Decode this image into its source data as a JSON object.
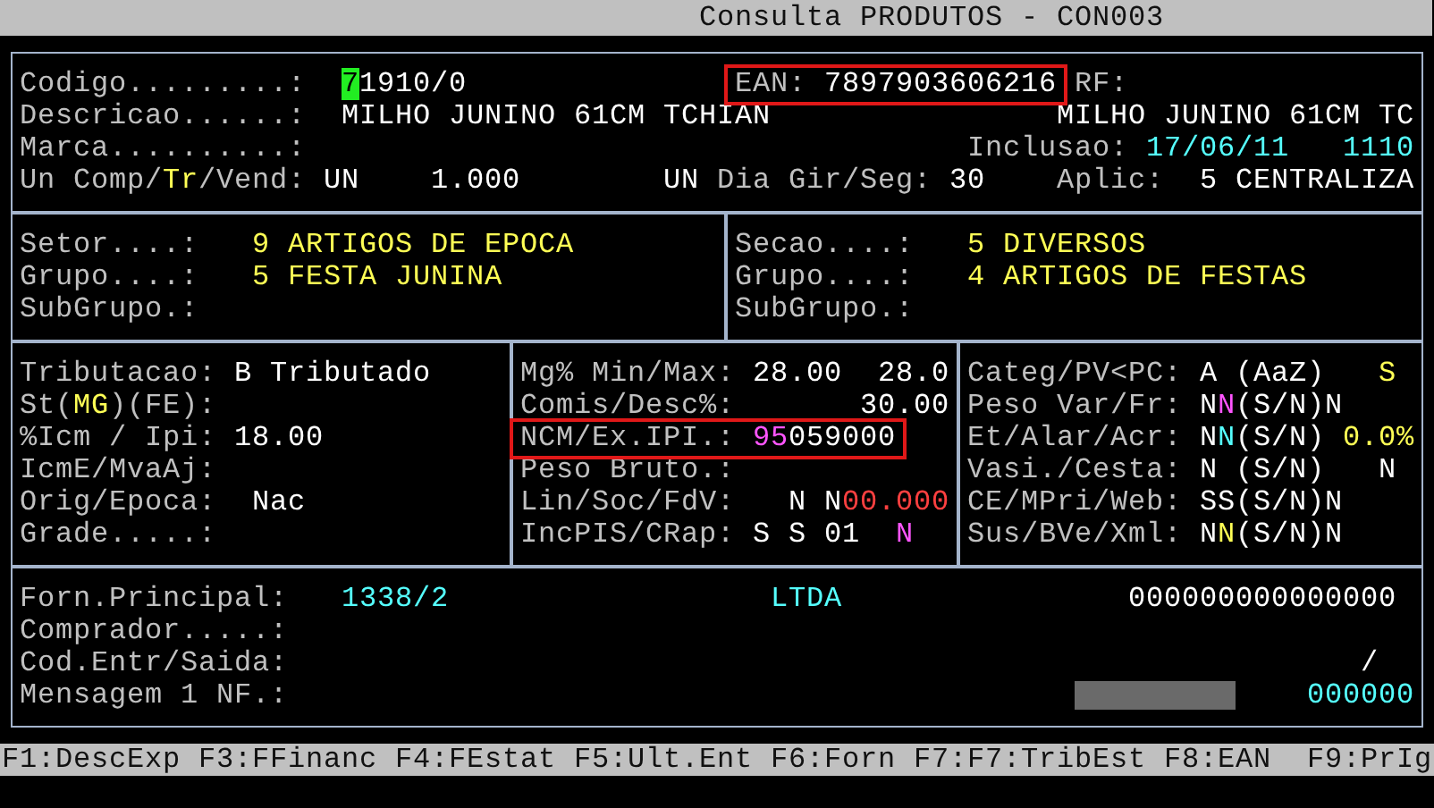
{
  "title": "Consulta PRODUTOS - CON003",
  "header": [
    [
      {
        "text": "Codigo.........:",
        "color": "#c0c0c0",
        "highlighted": false
      },
      {
        "text": "**7**1910/0",
        "color": "#ffffff",
        "cursor": true,
        "highlighted": false
      },
      {
        "text": "EAN:",
        "color": "#c0c0c0",
        "highlighted": true
      },
      {
        "text": "7897903606216",
        "color": "#ffffff",
        "highlighted": true
      },
      {
        "text": "RF:",
        "color": "#c0c0c0",
        "highlighted": false
      }
    ],
    [
      {
        "text": "Descricao......:",
        "color": "#c0c0c0"
      },
      {
        "text": "MILHO JUNINO 61CM TCHIAN",
        "color": "#ffffff"
      },
      {
        "text": "MILHO JUNINO 61CM TC",
        "color": "#ffffff"
      }
    ],
    [
      {
        "text": "Marca..........:",
        "color": "#c0c0c0"
      },
      {
        "text": "Inclusao:",
        "color": "#c0c0c0"
      },
      {
        "text": "17/06/11",
        "color": "#55ffff"
      },
      {
        "text": "1110",
        "color": "#55ffff"
      }
    ],
    [
      {
        "text": "Un Comp/**Tr**/Vend:",
        "color": "#c0c0c0",
        "accent": {
          "color": "#ffff55"
        }
      },
      {
        "text": "UN",
        "color": "#ffffff"
      },
      {
        "text": "1.000",
        "color": "#ffffff"
      },
      {
        "text": "UN",
        "color": "#ffffff"
      },
      {
        "text": "Dia Gir/Seg:",
        "color": "#c0c0c0"
      },
      {
        "text": "30",
        "color": "#ffffff"
      },
      {
        "text": "Aplic:",
        "color": "#c0c0c0"
      },
      {
        "text": "5 CENTRALIZA",
        "color": "#ffffff"
      }
    ]
  ],
  "classification": {
    "left": [
      [
        {
          "text": "Setor....:",
          "color": "#c0c0c0"
        },
        {
          "text": "9 ARTIGOS DE EPOCA",
          "color": "#ffff55"
        }
      ],
      [
        {
          "text": "Grupo....:",
          "color": "#c0c0c0"
        },
        {
          "text": "5 FESTA JUNINA",
          "color": "#ffff55"
        }
      ],
      [
        {
          "text": "SubGrupo.:",
          "color": "#c0c0c0"
        }
      ]
    ],
    "right": [
      [
        {
          "text": "Secao....:",
          "color": "#c0c0c0"
        },
        {
          "text": "5 DIVERSOS",
          "color": "#ffff55"
        }
      ],
      [
        {
          "text": "Grupo....:",
          "color": "#c0c0c0"
        },
        {
          "text": "4 ARTIGOS DE FESTAS",
          "color": "#ffff55"
        }
      ],
      [
        {
          "text": "SubGrupo.:",
          "color": "#c0c0c0"
        }
      ]
    ]
  },
  "taxes": {
    "left": [
      [
        {
          "text": "Tributacao:",
          "color": "#c0c0c0"
        },
        {
          "text": "B Tributado",
          "color": "#ffffff"
        }
      ],
      [
        {
          "text": "St(**MG**)(FE):",
          "color": "#c0c0c0",
          "accent": {
            "color": "#ffff55"
          }
        }
      ],
      [
        {
          "text": "%Icm / Ipi:",
          "color": "#c0c0c0"
        },
        {
          "text": "18.00",
          "color": "#ffffff"
        }
      ],
      [
        {
          "text": "IcmE/MvaAj:",
          "color": "#c0c0c0"
        }
      ],
      [
        {
          "text": "Orig/Epoca:",
          "color": "#c0c0c0"
        },
        {
          "text": "Nac",
          "color": "#ffffff"
        }
      ],
      [
        {
          "text": "Grade.....:",
          "color": "#c0c0c0"
        }
      ]
    ],
    "middle": [
      [
        {
          "text": "Mg% Min/Max:",
          "color": "#c0c0c0"
        },
        {
          "text": "28.00",
          "color": "#ffffff"
        },
        {
          "text": "28.0",
          "color": "#ffffff"
        }
      ],
      [
        {
          "text": "Comis/Desc%:",
          "color": "#c0c0c0"
        },
        {
          "text": "30.00",
          "color": "#ffffff"
        }
      ],
      [
        {
          "text": "NCM/Ex.IPI.:",
          "color": "#c0c0c0",
          "highlighted": true
        },
        {
          "text": "**95**059000",
          "color": "#ffffff",
          "accent": {
            "color": "#ff55ff"
          },
          "highlighted": true
        }
      ],
      [
        {
          "text": "Peso Bruto.:",
          "color": "#c0c0c0"
        }
      ],
      [
        {
          "text": "Lin/Soc/FdV:",
          "color": "#c0c0c0"
        },
        {
          "text": "N",
          "color": "#ffffff"
        },
        {
          "text": "N",
          "color": "#ffffff"
        },
        {
          "text": "00.000",
          "color": "#ff4040"
        }
      ],
      [
        {
          "text": "IncPIS/CRap:",
          "color": "#c0c0c0"
        },
        {
          "text": "S S 01",
          "color": "#ffffff"
        },
        {
          "text": "N",
          "color": "#ff55ff"
        }
      ]
    ],
    "right": [
      [
        {
          "text": "Categ/PV<PC:",
          "color": "#c0c0c0"
        },
        {
          "text": "A (AaZ)",
          "color": "#ffffff"
        },
        {
          "text": "S",
          "color": "#ffff55"
        }
      ],
      [
        {
          "text": "Peso Var/Fr:",
          "color": "#c0c0c0"
        },
        {
          "text": "N**N**(S/N)N",
          "color": "#ffffff",
          "accent": {
            "color": "#ff55ff"
          }
        }
      ],
      [
        {
          "text": "Et/Alar/Acr:",
          "color": "#c0c0c0"
        },
        {
          "text": "N**N**(S/N)",
          "color": "#ffffff",
          "accent": {
            "color": "#55ffff"
          }
        },
        {
          "text": "0.0%",
          "color": "#ffff55"
        }
      ],
      [
        {
          "text": "Vasi./Cesta:",
          "color": "#c0c0c0"
        },
        {
          "text": "N (S/N)",
          "color": "#ffffff"
        },
        {
          "text": "N",
          "color": "#ffffff"
        }
      ],
      [
        {
          "text": "CE/MPri/Web:",
          "color": "#c0c0c0"
        },
        {
          "text": "SS(S/N)N",
          "color": "#ffffff"
        }
      ],
      [
        {
          "text": "Sus/BVe/Xml:",
          "color": "#c0c0c0"
        },
        {
          "text": "N**N**(S/N)N",
          "color": "#ffffff",
          "accent": {
            "color": "#ffff55"
          }
        }
      ]
    ]
  },
  "supplier": [
    [
      {
        "text": "Forn.Principal:",
        "color": "#c0c0c0"
      },
      {
        "text": "1338/2",
        "color": "#55ffff"
      },
      {
        "text": "LTDA",
        "color": "#55ffff"
      },
      {
        "text": "000000000000000",
        "color": "#ffffff"
      }
    ],
    [
      {
        "text": "Comprador.....:",
        "color": "#c0c0c0"
      }
    ],
    [
      {
        "text": "Cod.Entr/Saida:",
        "color": "#c0c0c0"
      },
      {
        "text": "/",
        "color": "#ffffff"
      }
    ],
    [
      {
        "kind": "text",
        "text": "Mensagem 1 NF.:",
        "color": "#c0c0c0"
      },
      {
        "kind": "mask"
      },
      {
        "kind": "text",
        "text": "000000",
        "color": "#55ffff"
      }
    ]
  ],
  "function_keys": [
    "F1:DescExp",
    "F3:FFinanc",
    "F4:FEstat",
    "F5:Ult.Ent",
    "F6:Forn",
    "F7:F7:TribEst",
    "F8:EAN",
    "F9:PrIg"
  ]
}
